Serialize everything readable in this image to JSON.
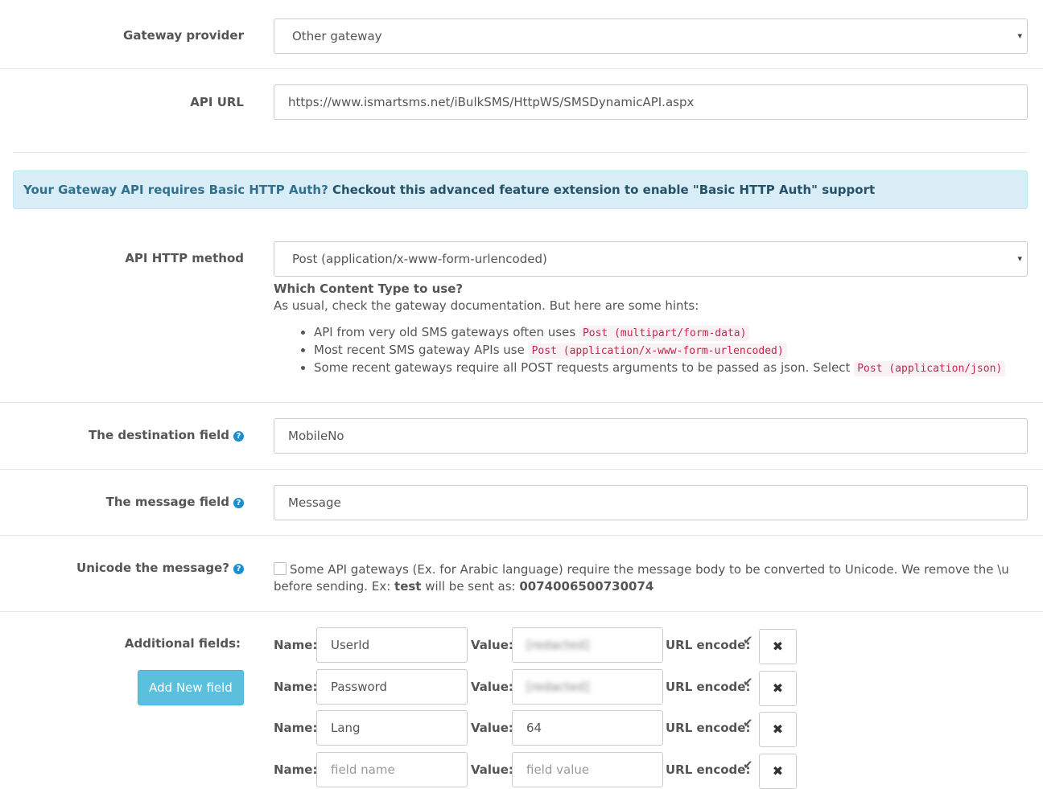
{
  "gateway": {
    "label": "Gateway provider",
    "value": "Other gateway"
  },
  "api_url": {
    "label": "API URL",
    "value": "https://www.ismartsms.net/iBulkSMS/HttpWS/SMSDynamicAPI.aspx"
  },
  "alert": {
    "question": "Your Gateway API requires Basic HTTP Auth?",
    "link": "Checkout this advanced feature extension to enable \"Basic HTTP Auth\" support"
  },
  "http_method": {
    "label": "API HTTP method",
    "value": "Post (application/x-www-form-urlencoded)",
    "hint_title": "Which Content Type to use?",
    "hint_sub": "As usual, check the gateway documentation. But here are some hints:",
    "hints": [
      {
        "text": "API from very old SMS gateways often uses ",
        "code": "Post (multipart/form-data)"
      },
      {
        "text": "Most recent SMS gateway APIs use ",
        "code": "Post (application/x-www-form-urlencoded)"
      },
      {
        "text": "Some recent gateways require all POST requests arguments to be passed as json. Select ",
        "code": "Post (application/json)"
      }
    ]
  },
  "destination": {
    "label": "The destination field",
    "value": "MobileNo"
  },
  "message": {
    "label": "The message field",
    "value": "Message"
  },
  "unicode": {
    "label": "Unicode the message?",
    "text_before": "Some API gateways (Ex. for Arabic language) require the message body to be converted to Unicode. We remove the \\u before sending. Ex: ",
    "example": "test",
    "text_mid": " will be sent as: ",
    "encoded": "0074006500730074"
  },
  "additional": {
    "label": "Additional fields:",
    "add_button": "Add New field",
    "name_label": "Name:",
    "value_label": "Value:",
    "encode_label": "URL encode:",
    "check_glyph": "✔",
    "delete_glyph": "✖",
    "name_placeholder": "field name",
    "value_placeholder": "field value",
    "rows": [
      {
        "name": "UserId",
        "value": "[redacted]"
      },
      {
        "name": "Password",
        "value": "[redacted]"
      },
      {
        "name": "Lang",
        "value": "64"
      }
    ]
  },
  "help_glyph": "?",
  "caret_glyph": "▾"
}
